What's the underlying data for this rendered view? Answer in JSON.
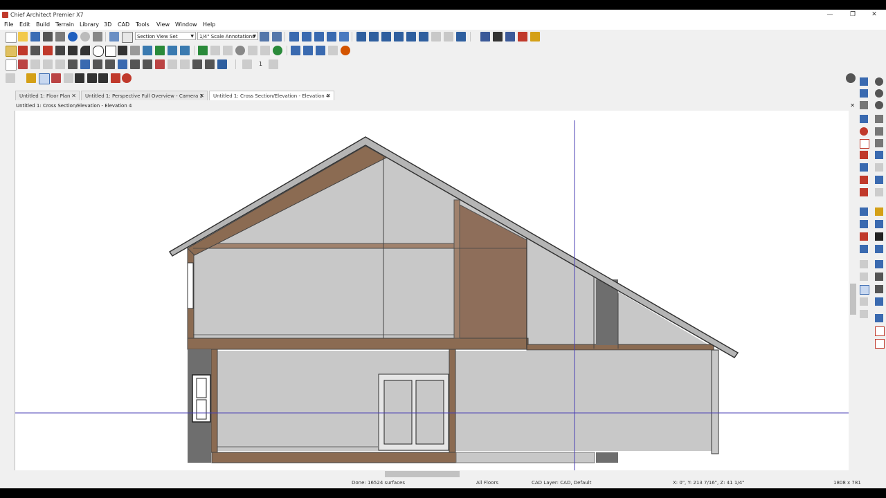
{
  "app": {
    "title": "Chief Architect Premier X7"
  },
  "window_controls": {
    "minimize": "—",
    "restore": "❐",
    "close": "✕"
  },
  "menu": [
    "File",
    "Edit",
    "Build",
    "Terrain",
    "Library",
    "3D",
    "CAD",
    "Tools",
    "View",
    "Window",
    "Help"
  ],
  "toolbar": {
    "view_set": "Section View Set",
    "annotation_set": "1/4\" Scale Annotations",
    "stepper_value": "1"
  },
  "tabs": [
    {
      "label": "Untitled 1: Floor Plan",
      "close": "✕"
    },
    {
      "label": "Untitled 1: Perspective Full Overview - Camera 3",
      "close": "✕"
    },
    {
      "label": "Untitled 1: Cross Section/Elevation - Elevation 4",
      "close": "✕"
    }
  ],
  "view_header": {
    "title": "Untitled 1: Cross Section/Elevation - Elevation 4",
    "close": "✕"
  },
  "status": {
    "progress": "Done:  16524 surfaces",
    "floor": "All Floors",
    "layer": "CAD Layer: CAD,  Default",
    "coords": "X: 0\", Y: 213 7/16\", Z: 41 1/4\"",
    "size": "1808 x 781"
  },
  "colors": {
    "wall_fill": "#c8c8c8",
    "framing": "#8b6b52",
    "roof": "#b5b5b5",
    "crosshair": "#4a3fb5",
    "siding": "#6e6e6e"
  }
}
